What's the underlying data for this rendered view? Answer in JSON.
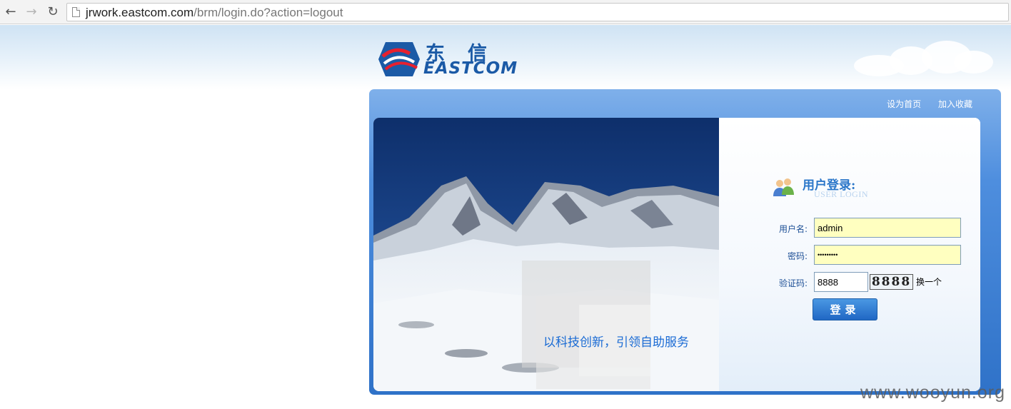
{
  "browser": {
    "back_icon": "back-arrow-icon",
    "forward_icon": "forward-arrow-icon",
    "reload_icon": "reload-icon",
    "url_host": "jrwork.eastcom.com",
    "url_path": "/brm/login.do?action=logout"
  },
  "header": {
    "logo_cn": "东信",
    "logo_en": "EASTCOM",
    "links": [
      "设为首页",
      "加入收藏"
    ]
  },
  "banner": {
    "slogan": "以科技创新，引领自助服务"
  },
  "login": {
    "title": "用户登录:",
    "subtitle": "USER LOGIN",
    "username_label": "用户名:",
    "username_value": "admin",
    "password_label": "密码:",
    "password_value": "•••••••••",
    "captcha_label": "验证码:",
    "captcha_value": "8888",
    "captcha_image_text": "8888",
    "captcha_refresh": "换一个",
    "submit_label": "登录"
  },
  "watermark": "www.wooyun.org",
  "colors": {
    "brand_blue": "#1b5aa6",
    "frame_blue": "#4e8ede",
    "input_yellow": "#ffffc0"
  }
}
